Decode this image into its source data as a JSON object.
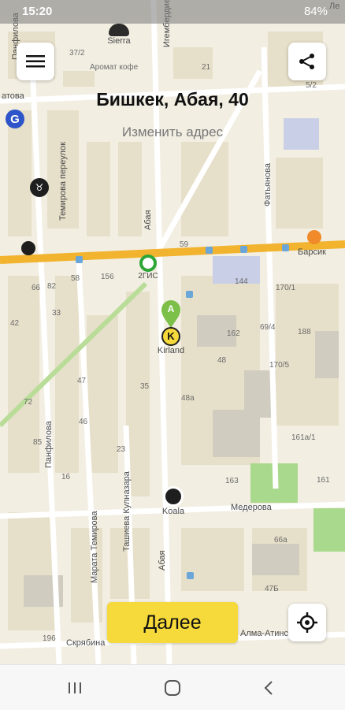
{
  "status_bar": {
    "time": "15:20",
    "battery": "84%"
  },
  "header": {
    "address": "Бишкек, Абая, 40",
    "change_address": "Изменить адрес"
  },
  "actions": {
    "next_label": "Далее"
  },
  "map": {
    "streets": {
      "abaya_vertical": "Абая",
      "abaya_lower": "Абая",
      "temirova_per": "Темирова переулок",
      "panfilova": "Панфилова",
      "panfilova_top": "Панфилова",
      "fatyanova": "Фатьянова",
      "medeova": "Медерова",
      "marata_temirova": "Марата Темирова",
      "tashieva": "Ташиева Кулназара",
      "skryabina": "Скрябина",
      "alma_ata": "Алма-Атинская",
      "igemberdieva": "Игембердиева",
      "top_left": "атова",
      "top_right": "Ле"
    },
    "pois": {
      "sierra": "Sierra",
      "sierra_sub": "Аромат кофе",
      "two_gis": "2ГИС",
      "kirland": "Kirland",
      "koala": "Koala",
      "barsik": "Барсик",
      "pin_letter": "A",
      "kirland_letter": "K"
    },
    "house_numbers": [
      "37/2",
      "21",
      "5/2",
      "66",
      "42",
      "33",
      "58",
      "156",
      "82",
      "144",
      "170/1",
      "69/4",
      "188",
      "47",
      "72",
      "162",
      "170/5",
      "35",
      "48",
      "48a",
      "46",
      "161a/1",
      "85",
      "16",
      "23",
      "163",
      "161",
      "66a",
      "47Б",
      "196",
      "59"
    ]
  }
}
